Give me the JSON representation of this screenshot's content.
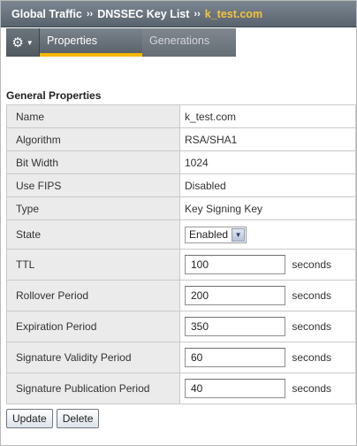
{
  "breadcrumb": {
    "items": [
      "Global Traffic",
      "DNSSEC Key List",
      "k_test.com"
    ],
    "separator": "››"
  },
  "tabs": [
    {
      "label": "Properties",
      "active": true
    },
    {
      "label": "Generations",
      "active": false
    }
  ],
  "section_title": "General Properties",
  "properties": {
    "name": {
      "label": "Name",
      "value": "k_test.com"
    },
    "algorithm": {
      "label": "Algorithm",
      "value": "RSA/SHA1"
    },
    "bit_width": {
      "label": "Bit Width",
      "value": "1024"
    },
    "use_fips": {
      "label": "Use FIPS",
      "value": "Disabled"
    },
    "type": {
      "label": "Type",
      "value": "Key Signing Key"
    },
    "state": {
      "label": "State",
      "selected": "Enabled"
    },
    "ttl": {
      "label": "TTL",
      "value": "100",
      "unit": "seconds"
    },
    "rollover": {
      "label": "Rollover Period",
      "value": "200",
      "unit": "seconds"
    },
    "expiration": {
      "label": "Expiration Period",
      "value": "350",
      "unit": "seconds"
    },
    "sig_validity": {
      "label": "Signature Validity Period",
      "value": "60",
      "unit": "seconds"
    },
    "sig_publication": {
      "label": "Signature Publication Period",
      "value": "40",
      "unit": "seconds"
    }
  },
  "buttons": {
    "update": "Update",
    "delete": "Delete"
  },
  "colors": {
    "accent": "#f5b800",
    "breadcrumb_link": "#f5c33b",
    "header_bg": "#58636e"
  },
  "icons": {
    "menu": "gear-icon",
    "menu_caret": "chevron-down-icon",
    "select_arrow": "chevron-down-icon"
  }
}
